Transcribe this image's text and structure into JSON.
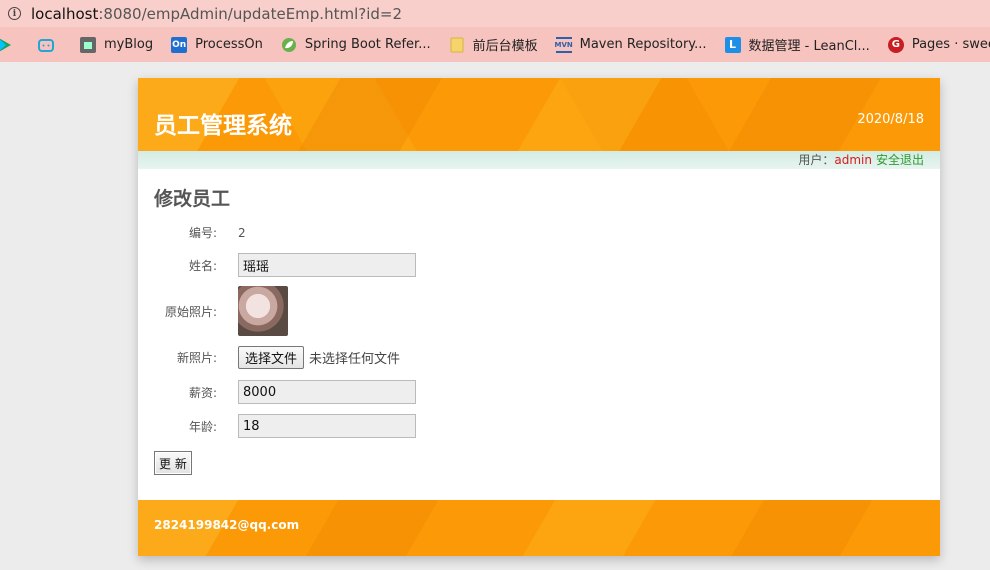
{
  "browser": {
    "url_host": "localhost",
    "url_path": ":8080/empAdmin/updateEmp.html?id=2",
    "bookmarks": [
      {
        "label": "",
        "icon": "play-store-icon",
        "color": "#1aa260"
      },
      {
        "label": "",
        "icon": "bilibili-icon",
        "color": "#23a6d5"
      },
      {
        "label": "myBlog",
        "icon": "blog-icon",
        "color": "#555555"
      },
      {
        "label": "ProcessOn",
        "icon": "processon-icon",
        "color": "#1f6fd1"
      },
      {
        "label": "Spring Boot Refer...",
        "icon": "spring-leaf-icon",
        "color": "#6ab04c"
      },
      {
        "label": "前后台模板",
        "icon": "folder-icon",
        "color": "#f5d56b"
      },
      {
        "label": "Maven Repository...",
        "icon": "mvn-icon",
        "color": "#2f5fa8"
      },
      {
        "label": "数据管理 - LeanCl...",
        "icon": "leancloud-icon",
        "color": "#1e8fe6"
      },
      {
        "label": "Pages · sweetboy...",
        "icon": "gitee-icon",
        "color": "#c71d23"
      }
    ]
  },
  "header": {
    "title": "员工管理系统",
    "date": "2020/8/18"
  },
  "userbar": {
    "prefix": "用户：",
    "username": "admin",
    "logout": "安全退出"
  },
  "form": {
    "page_title": "修改员工",
    "id_label": "编号:",
    "id_value": "2",
    "name_label": "姓名:",
    "name_value": "瑶瑶",
    "photo_label": "原始照片:",
    "new_photo_label": "新照片:",
    "file_button": "选择文件",
    "file_none": "未选择任何文件",
    "salary_label": "薪资:",
    "salary_value": "8000",
    "age_label": "年龄:",
    "age_value": "18",
    "submit": "更 新"
  },
  "footer": {
    "email": "2824199842@qq.com"
  },
  "colors": {
    "brand_orange": "#fb9a06",
    "username_red": "#d81b1b",
    "logout_green": "#2e9b2e"
  }
}
